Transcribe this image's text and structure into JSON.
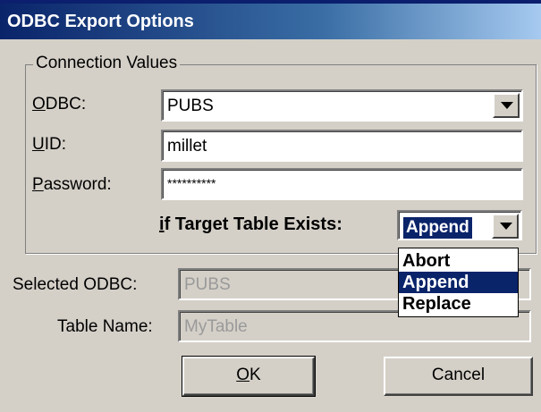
{
  "window": {
    "title": "ODBC Export Options"
  },
  "connection": {
    "legend": "Connection Values",
    "odbc_label": "ODBC:",
    "odbc_value": "PUBS",
    "uid_label": "UID:",
    "uid_value": "millet",
    "password_label": "Password:",
    "password_value": "**********"
  },
  "target": {
    "label": "if Target Table Exists:",
    "selected": "Append",
    "options": [
      "Abort",
      "Append",
      "Replace"
    ]
  },
  "selected_odbc": {
    "label": "Selected ODBC:",
    "value": "PUBS"
  },
  "table_name": {
    "label": "Table Name:",
    "value": "MyTable"
  },
  "buttons": {
    "ok": "OK",
    "cancel": "Cancel"
  }
}
